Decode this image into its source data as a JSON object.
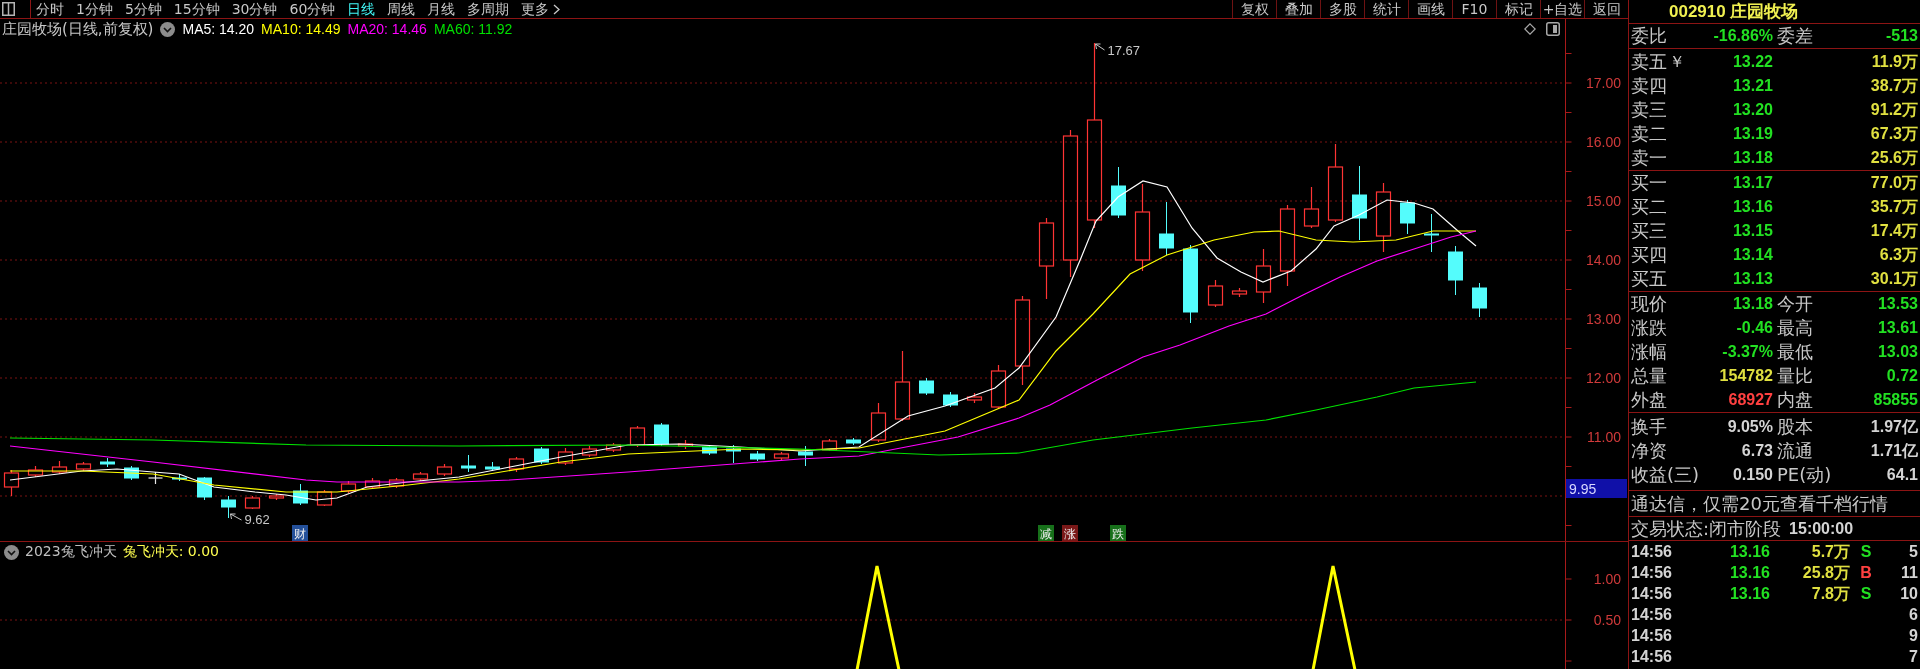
{
  "toolbar": {
    "periods": [
      {
        "label": "分时",
        "selected": false
      },
      {
        "label": "1分钟",
        "selected": false
      },
      {
        "label": "5分钟",
        "selected": false
      },
      {
        "label": "15分钟",
        "selected": false
      },
      {
        "label": "30分钟",
        "selected": false
      },
      {
        "label": "60分钟",
        "selected": false
      },
      {
        "label": "日线",
        "selected": true
      },
      {
        "label": "周线",
        "selected": false
      },
      {
        "label": "月线",
        "selected": false
      },
      {
        "label": "多周期",
        "selected": false
      }
    ],
    "more": {
      "label": "更多"
    },
    "actions": [
      "复权",
      "叠加",
      "多股",
      "统计",
      "画线",
      "F10",
      "标记",
      "+自选",
      "返回"
    ]
  },
  "main_chart": {
    "title": "庄园牧场(日线,前复权)",
    "moving_averages": [
      {
        "label": "MA5: 14.20",
        "color": "#ffffff"
      },
      {
        "label": "MA10: 14.49",
        "color": "#ffff00"
      },
      {
        "label": "MA20: 14.46",
        "color": "#ff00ff"
      },
      {
        "label": "MA60: 11.92",
        "color": "#00e000"
      }
    ],
    "price_axis": [
      "17.00",
      "16.00",
      "15.00",
      "14.00",
      "13.00",
      "12.00",
      "11.00"
    ],
    "cursor_price": "9.95",
    "high_label": "17.67",
    "low_label": "9.62",
    "markers": [
      {
        "label": "财",
        "color": "#24509a"
      },
      {
        "label": "减",
        "color": "#17701a"
      },
      {
        "label": "涨",
        "color": "#7a1818"
      },
      {
        "label": "跌",
        "color": "#17701a"
      }
    ]
  },
  "indicator_pane": {
    "title": "2023兔飞冲天",
    "reading": "兔飞冲天: 0.00",
    "axis": [
      "1.00",
      "0.50"
    ]
  },
  "quote": {
    "title": "002910 庄园牧场",
    "order_balance": [
      {
        "label": "委比",
        "value": "-16.86%",
        "color": "#22e022"
      },
      {
        "label": "委差",
        "value": "-513",
        "color": "#22e022"
      }
    ],
    "asks": [
      {
        "label": "卖五",
        "symbol": "￥",
        "price": "13.22",
        "color": "#22e022",
        "volume": "11.9万"
      },
      {
        "label": "卖四",
        "price": "13.21",
        "color": "#22e022",
        "volume": "38.7万"
      },
      {
        "label": "卖三",
        "price": "13.20",
        "color": "#22e022",
        "volume": "91.2万"
      },
      {
        "label": "卖二",
        "price": "13.19",
        "color": "#22e022",
        "volume": "67.3万"
      },
      {
        "label": "卖一",
        "price": "13.18",
        "color": "#22e022",
        "volume": "25.6万"
      }
    ],
    "bids": [
      {
        "label": "买一",
        "price": "13.17",
        "color": "#22e022",
        "volume": "77.0万"
      },
      {
        "label": "买二",
        "price": "13.16",
        "color": "#22e022",
        "volume": "35.7万"
      },
      {
        "label": "买三",
        "price": "13.15",
        "color": "#22e022",
        "volume": "17.4万"
      },
      {
        "label": "买四",
        "price": "13.14",
        "color": "#22e022",
        "volume": "6.3万"
      },
      {
        "label": "买五",
        "price": "13.13",
        "color": "#22e022",
        "volume": "30.1万"
      }
    ],
    "stats": [
      [
        {
          "label": "现价",
          "value": "13.18",
          "color": "#22e022"
        },
        {
          "label": "今开",
          "value": "13.53",
          "color": "#22e022"
        }
      ],
      [
        {
          "label": "涨跌",
          "value": "-0.46",
          "color": "#22e022"
        },
        {
          "label": "最高",
          "value": "13.61",
          "color": "#22e022"
        }
      ],
      [
        {
          "label": "涨幅",
          "value": "-3.37%",
          "color": "#22e022"
        },
        {
          "label": "最低",
          "value": "13.03",
          "color": "#22e022"
        }
      ],
      [
        {
          "label": "总量",
          "value": "154782",
          "color": "#e0e040"
        },
        {
          "label": "量比",
          "value": "0.72",
          "color": "#22e022"
        }
      ],
      [
        {
          "label": "外盘",
          "value": "68927",
          "color": "#ff4040"
        },
        {
          "label": "内盘",
          "value": "85855",
          "color": "#22e022"
        }
      ]
    ],
    "fundamentals": [
      [
        {
          "label": "换手",
          "value": "9.05%",
          "color": "#d4d4d4"
        },
        {
          "label": "股本",
          "value": "1.97亿",
          "color": "#d4d4d4"
        }
      ],
      [
        {
          "label": "净资",
          "value": "6.73",
          "color": "#d4d4d4"
        },
        {
          "label": "流通",
          "value": "1.71亿",
          "color": "#d4d4d4"
        }
      ],
      [
        {
          "label": "收益(三)",
          "value": "0.150",
          "color": "#d4d4d4"
        },
        {
          "label": "PE(动)",
          "value": "64.1",
          "color": "#d4d4d4"
        }
      ]
    ],
    "notice": "通达信，仅需20元查看千档行情",
    "trading_status": {
      "label": "交易状态:闭市阶段",
      "time": "15:00:00"
    },
    "ticks": [
      {
        "time": "14:56",
        "price": "13.16",
        "color": "#22e022",
        "volume": "5.7万",
        "side": {
          "label": "S",
          "color": "#22e022"
        },
        "count": "5"
      },
      {
        "time": "14:56",
        "price": "13.16",
        "color": "#22e022",
        "volume": "25.8万",
        "side": {
          "label": "B",
          "color": "#ff4040"
        },
        "count": "11"
      },
      {
        "time": "14:56",
        "price": "13.16",
        "color": "#22e022",
        "volume": "7.8万",
        "side": {
          "label": "S",
          "color": "#22e022"
        },
        "count": "10"
      },
      {
        "time": "14:56",
        "count": "6"
      },
      {
        "time": "14:56",
        "count": "9"
      },
      {
        "time": "14:56",
        "count": "7"
      }
    ]
  }
}
